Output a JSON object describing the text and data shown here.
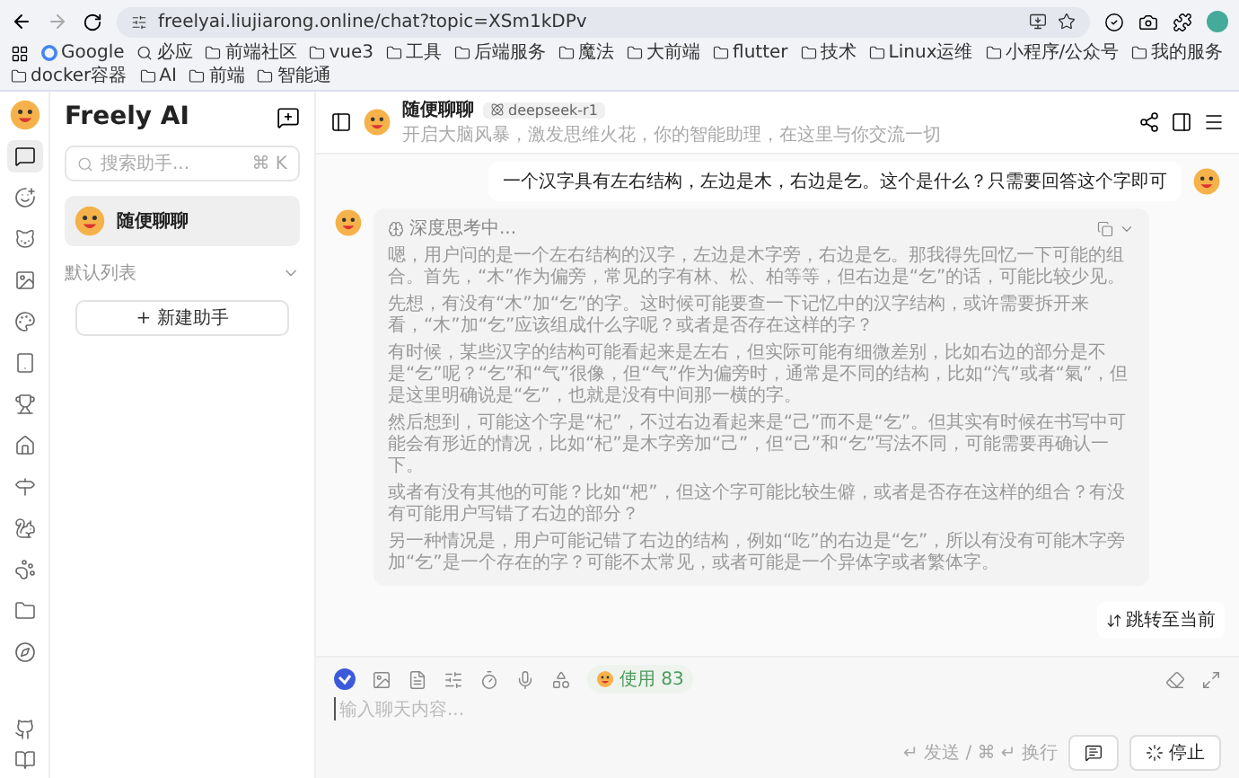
{
  "browser": {
    "url": "freelyai.liujiarong.online/chat?topic=XSm1kDPv",
    "bookmarks": [
      {
        "label": "Google",
        "kind": "site"
      },
      {
        "label": "必应",
        "kind": "search"
      },
      {
        "label": "前端社区",
        "kind": "folder"
      },
      {
        "label": "vue3",
        "kind": "folder"
      },
      {
        "label": "工具",
        "kind": "folder"
      },
      {
        "label": "后端服务",
        "kind": "folder"
      },
      {
        "label": "魔法",
        "kind": "folder"
      },
      {
        "label": "大前端",
        "kind": "folder"
      },
      {
        "label": "flutter",
        "kind": "folder"
      },
      {
        "label": "技术",
        "kind": "folder"
      },
      {
        "label": "Linux运维",
        "kind": "folder"
      },
      {
        "label": "小程序/公众号",
        "kind": "folder"
      },
      {
        "label": "我的服务",
        "kind": "folder"
      },
      {
        "label": "docker容器",
        "kind": "folder"
      },
      {
        "label": "AI",
        "kind": "folder"
      },
      {
        "label": "前端",
        "kind": "folder"
      },
      {
        "label": "智能通",
        "kind": "folder"
      }
    ]
  },
  "rail": {
    "items": [
      {
        "kind": "chat",
        "selected": true
      },
      {
        "kind": "smile",
        "selected": false
      },
      {
        "kind": "cat",
        "selected": false
      },
      {
        "kind": "image",
        "selected": false
      },
      {
        "kind": "palette",
        "selected": false
      },
      {
        "kind": "tablet",
        "selected": false
      },
      {
        "kind": "trophy",
        "selected": false
      },
      {
        "kind": "home",
        "selected": false
      },
      {
        "kind": "signpost",
        "selected": false
      },
      {
        "kind": "fox",
        "selected": false
      },
      {
        "kind": "paw",
        "selected": false
      },
      {
        "kind": "folder",
        "selected": false
      },
      {
        "kind": "compass",
        "selected": false
      }
    ],
    "bottom": [
      {
        "kind": "github"
      },
      {
        "kind": "book"
      }
    ]
  },
  "sidebar": {
    "title": "Freely AI",
    "search": {
      "placeholder": "搜索助手...",
      "shortcut": "⌘ K"
    },
    "items": [
      {
        "name": "随便聊聊",
        "selected": true
      }
    ],
    "group": {
      "label": "默认列表",
      "expanded": true
    },
    "new_button": "+ 新建助手"
  },
  "header": {
    "title": "随便聊聊",
    "model": "deepseek-r1",
    "subtitle": "开启大脑风暴，激发思维火花，你的智能助理，在这里与你交流一切"
  },
  "messages": [
    {
      "kind": "user",
      "text": "一个汉字具有左右结构，左边是木，右边是乞。这个是什么？只需要回答这个字即可"
    },
    {
      "kind": "thinking",
      "status": "深度思考中...",
      "paragraphs": [
        "嗯，用户问的是一个左右结构的汉字，左边是木字旁，右边是乞。那我得先回忆一下可能的组合。首先，“木”作为偏旁，常见的字有林、松、柏等等，但右边是“乞”的话，可能比较少见。",
        "先想，有没有“木”加“乞”的字。这时候可能要查一下记忆中的汉字结构，或许需要拆开来看，“木”加“乞”应该组成什么字呢？或者是否存在这样的字？",
        "有时候，某些汉字的结构可能看起来是左右，但实际可能有细微差别，比如右边的部分是不是“乞”呢？“乞”和“气”很像，但“气”作为偏旁时，通常是不同的结构，比如“汽”或者“氣”，但是这里明确说是“乞”，也就是没有中间那一横的字。",
        "然后想到，可能这个字是“杞”，不过右边看起来是“己”而不是“乞”。但其实有时候在书写中可能会有形近的情况，比如“杞”是木字旁加“己”，但“己”和“乞”写法不同，可能需要再确认一下。",
        "或者有没有其他的可能？比如“杷”，但这个字可能比较生僻，或者是否存在这样的组合？有没有可能用户写错了右边的部分？",
        "另一种情况是，用户可能记错了右边的结构，例如“吃”的右边是“乞”，所以有没有可能木字旁加“乞”是一个存在的字？可能不太常见，或者可能是一个异体字或者繁体字。"
      ]
    }
  ],
  "jump_button": "跳转至当前",
  "composer": {
    "tools": [
      {
        "kind": "model"
      },
      {
        "kind": "image"
      },
      {
        "kind": "file"
      },
      {
        "kind": "sliders"
      },
      {
        "kind": "timer"
      },
      {
        "kind": "mic"
      },
      {
        "kind": "plugin"
      }
    ],
    "usage": "使用 83",
    "placeholder": "输入聊天内容...",
    "hint": "↵ 发送 / ⌘ ↵ 换行",
    "stop_button": "停止"
  }
}
